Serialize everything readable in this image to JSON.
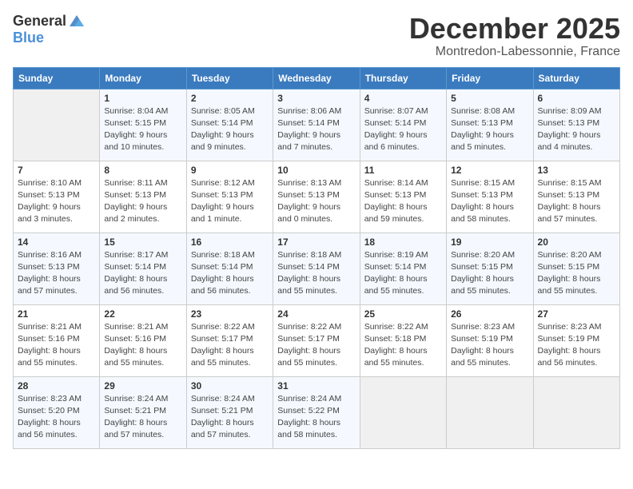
{
  "logo": {
    "general": "General",
    "blue": "Blue"
  },
  "title": {
    "month": "December 2025",
    "location": "Montredon-Labessonnie, France"
  },
  "headers": [
    "Sunday",
    "Monday",
    "Tuesday",
    "Wednesday",
    "Thursday",
    "Friday",
    "Saturday"
  ],
  "weeks": [
    [
      {
        "day": "",
        "info": ""
      },
      {
        "day": "1",
        "info": "Sunrise: 8:04 AM\nSunset: 5:15 PM\nDaylight: 9 hours\nand 10 minutes."
      },
      {
        "day": "2",
        "info": "Sunrise: 8:05 AM\nSunset: 5:14 PM\nDaylight: 9 hours\nand 9 minutes."
      },
      {
        "day": "3",
        "info": "Sunrise: 8:06 AM\nSunset: 5:14 PM\nDaylight: 9 hours\nand 7 minutes."
      },
      {
        "day": "4",
        "info": "Sunrise: 8:07 AM\nSunset: 5:14 PM\nDaylight: 9 hours\nand 6 minutes."
      },
      {
        "day": "5",
        "info": "Sunrise: 8:08 AM\nSunset: 5:13 PM\nDaylight: 9 hours\nand 5 minutes."
      },
      {
        "day": "6",
        "info": "Sunrise: 8:09 AM\nSunset: 5:13 PM\nDaylight: 9 hours\nand 4 minutes."
      }
    ],
    [
      {
        "day": "7",
        "info": "Sunrise: 8:10 AM\nSunset: 5:13 PM\nDaylight: 9 hours\nand 3 minutes."
      },
      {
        "day": "8",
        "info": "Sunrise: 8:11 AM\nSunset: 5:13 PM\nDaylight: 9 hours\nand 2 minutes."
      },
      {
        "day": "9",
        "info": "Sunrise: 8:12 AM\nSunset: 5:13 PM\nDaylight: 9 hours\nand 1 minute."
      },
      {
        "day": "10",
        "info": "Sunrise: 8:13 AM\nSunset: 5:13 PM\nDaylight: 9 hours\nand 0 minutes."
      },
      {
        "day": "11",
        "info": "Sunrise: 8:14 AM\nSunset: 5:13 PM\nDaylight: 8 hours\nand 59 minutes."
      },
      {
        "day": "12",
        "info": "Sunrise: 8:15 AM\nSunset: 5:13 PM\nDaylight: 8 hours\nand 58 minutes."
      },
      {
        "day": "13",
        "info": "Sunrise: 8:15 AM\nSunset: 5:13 PM\nDaylight: 8 hours\nand 57 minutes."
      }
    ],
    [
      {
        "day": "14",
        "info": "Sunrise: 8:16 AM\nSunset: 5:13 PM\nDaylight: 8 hours\nand 57 minutes."
      },
      {
        "day": "15",
        "info": "Sunrise: 8:17 AM\nSunset: 5:14 PM\nDaylight: 8 hours\nand 56 minutes."
      },
      {
        "day": "16",
        "info": "Sunrise: 8:18 AM\nSunset: 5:14 PM\nDaylight: 8 hours\nand 56 minutes."
      },
      {
        "day": "17",
        "info": "Sunrise: 8:18 AM\nSunset: 5:14 PM\nDaylight: 8 hours\nand 55 minutes."
      },
      {
        "day": "18",
        "info": "Sunrise: 8:19 AM\nSunset: 5:14 PM\nDaylight: 8 hours\nand 55 minutes."
      },
      {
        "day": "19",
        "info": "Sunrise: 8:20 AM\nSunset: 5:15 PM\nDaylight: 8 hours\nand 55 minutes."
      },
      {
        "day": "20",
        "info": "Sunrise: 8:20 AM\nSunset: 5:15 PM\nDaylight: 8 hours\nand 55 minutes."
      }
    ],
    [
      {
        "day": "21",
        "info": "Sunrise: 8:21 AM\nSunset: 5:16 PM\nDaylight: 8 hours\nand 55 minutes."
      },
      {
        "day": "22",
        "info": "Sunrise: 8:21 AM\nSunset: 5:16 PM\nDaylight: 8 hours\nand 55 minutes."
      },
      {
        "day": "23",
        "info": "Sunrise: 8:22 AM\nSunset: 5:17 PM\nDaylight: 8 hours\nand 55 minutes."
      },
      {
        "day": "24",
        "info": "Sunrise: 8:22 AM\nSunset: 5:17 PM\nDaylight: 8 hours\nand 55 minutes."
      },
      {
        "day": "25",
        "info": "Sunrise: 8:22 AM\nSunset: 5:18 PM\nDaylight: 8 hours\nand 55 minutes."
      },
      {
        "day": "26",
        "info": "Sunrise: 8:23 AM\nSunset: 5:19 PM\nDaylight: 8 hours\nand 55 minutes."
      },
      {
        "day": "27",
        "info": "Sunrise: 8:23 AM\nSunset: 5:19 PM\nDaylight: 8 hours\nand 56 minutes."
      }
    ],
    [
      {
        "day": "28",
        "info": "Sunrise: 8:23 AM\nSunset: 5:20 PM\nDaylight: 8 hours\nand 56 minutes."
      },
      {
        "day": "29",
        "info": "Sunrise: 8:24 AM\nSunset: 5:21 PM\nDaylight: 8 hours\nand 57 minutes."
      },
      {
        "day": "30",
        "info": "Sunrise: 8:24 AM\nSunset: 5:21 PM\nDaylight: 8 hours\nand 57 minutes."
      },
      {
        "day": "31",
        "info": "Sunrise: 8:24 AM\nSunset: 5:22 PM\nDaylight: 8 hours\nand 58 minutes."
      },
      {
        "day": "",
        "info": ""
      },
      {
        "day": "",
        "info": ""
      },
      {
        "day": "",
        "info": ""
      }
    ]
  ]
}
